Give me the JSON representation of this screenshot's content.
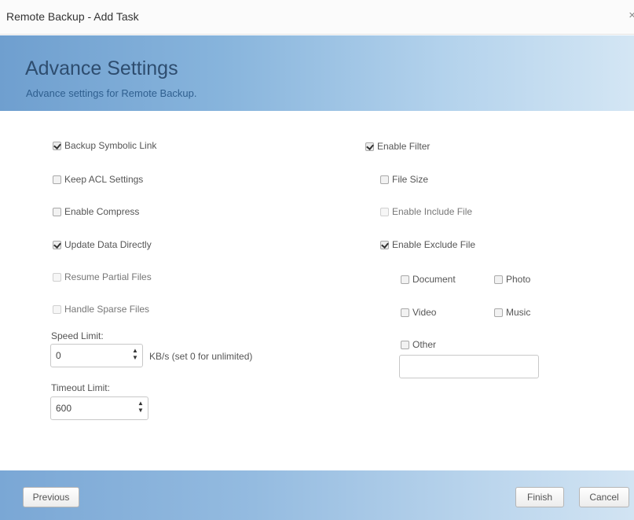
{
  "window": {
    "title": "Remote Backup - Add Task",
    "close_glyph": "×"
  },
  "header": {
    "title": "Advance Settings",
    "subtitle": "Advance settings for Remote Backup."
  },
  "left_options": [
    {
      "label": "Backup Symbolic Link",
      "checked": true,
      "disabled": false
    },
    {
      "label": "Keep ACL Settings",
      "checked": false,
      "disabled": false
    },
    {
      "label": "Enable Compress",
      "checked": false,
      "disabled": false
    },
    {
      "label": "Update Data Directly",
      "checked": true,
      "disabled": false
    },
    {
      "label": "Resume Partial Files",
      "checked": false,
      "disabled": true
    },
    {
      "label": "Handle Sparse Files",
      "checked": false,
      "disabled": true
    }
  ],
  "speed_limit": {
    "label": "Speed Limit:",
    "value": "0",
    "note": "KB/s (set 0 for unlimited)"
  },
  "timeout_limit": {
    "label": "Timeout Limit:",
    "value": "600"
  },
  "filter": {
    "enable_filter": {
      "label": "Enable Filter",
      "checked": true
    },
    "file_size": {
      "label": "File Size",
      "checked": false
    },
    "enable_include": {
      "label": "Enable Include File",
      "checked": false,
      "disabled": true
    },
    "enable_exclude": {
      "label": "Enable Exclude File",
      "checked": true
    },
    "types": {
      "document": {
        "label": "Document",
        "checked": false
      },
      "photo": {
        "label": "Photo",
        "checked": false
      },
      "video": {
        "label": "Video",
        "checked": false
      },
      "music": {
        "label": "Music",
        "checked": false
      },
      "other": {
        "label": "Other",
        "checked": false
      }
    },
    "other_value": ""
  },
  "footer": {
    "previous": "Previous",
    "finish": "Finish",
    "cancel": "Cancel"
  },
  "colors": {
    "header_gradient_start": "#6f9fcf",
    "header_gradient_end": "#d4e6f4",
    "title_text": "#2e4d6f"
  }
}
